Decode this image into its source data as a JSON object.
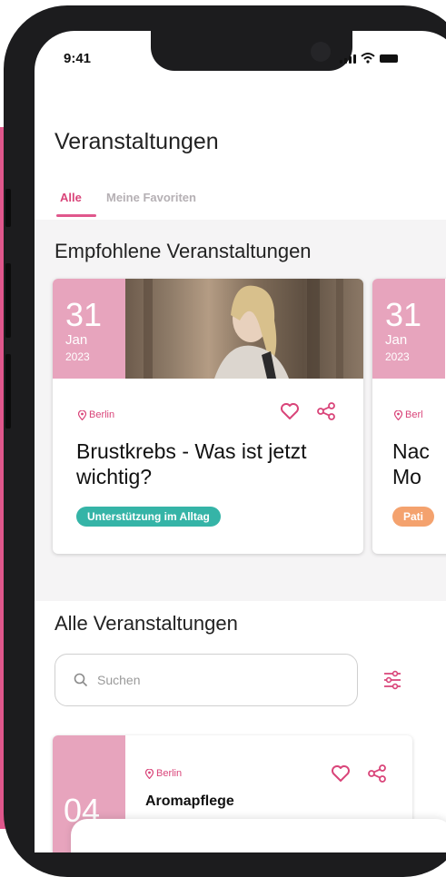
{
  "status_bar": {
    "time": "9:41"
  },
  "page_title": "Veranstaltungen",
  "tabs": [
    {
      "label": "Alle",
      "active": true
    },
    {
      "label": "Meine Favoriten",
      "active": false
    }
  ],
  "featured": {
    "heading": "Empfohlene Veranstaltungen",
    "cards": [
      {
        "day": "31",
        "month": "Jan",
        "year": "2023",
        "location": "Berlin",
        "title": "Brustkrebs - Was ist jetzt wichtig?",
        "tag": "Unterstützung im Alltag",
        "tag_color": "#35b4a7"
      },
      {
        "day": "31",
        "month": "Jan",
        "year": "2023",
        "location": "Berl",
        "title": "Nac Mo",
        "tag": "Pati",
        "tag_color": "#f4a26e"
      }
    ]
  },
  "all_events": {
    "heading": "Alle Veranstaltungen",
    "search_placeholder": "Suchen",
    "items": [
      {
        "day": "04",
        "location": "Berlin",
        "title": "Aromapflege"
      }
    ]
  },
  "colors": {
    "accent": "#e0578c",
    "date_box": "#e7a4bd",
    "tag_teal": "#35b4a7",
    "tag_orange": "#f4a26e"
  },
  "icons": [
    "location-pin-icon",
    "heart-icon",
    "share-icon",
    "search-icon",
    "filter-icon"
  ]
}
